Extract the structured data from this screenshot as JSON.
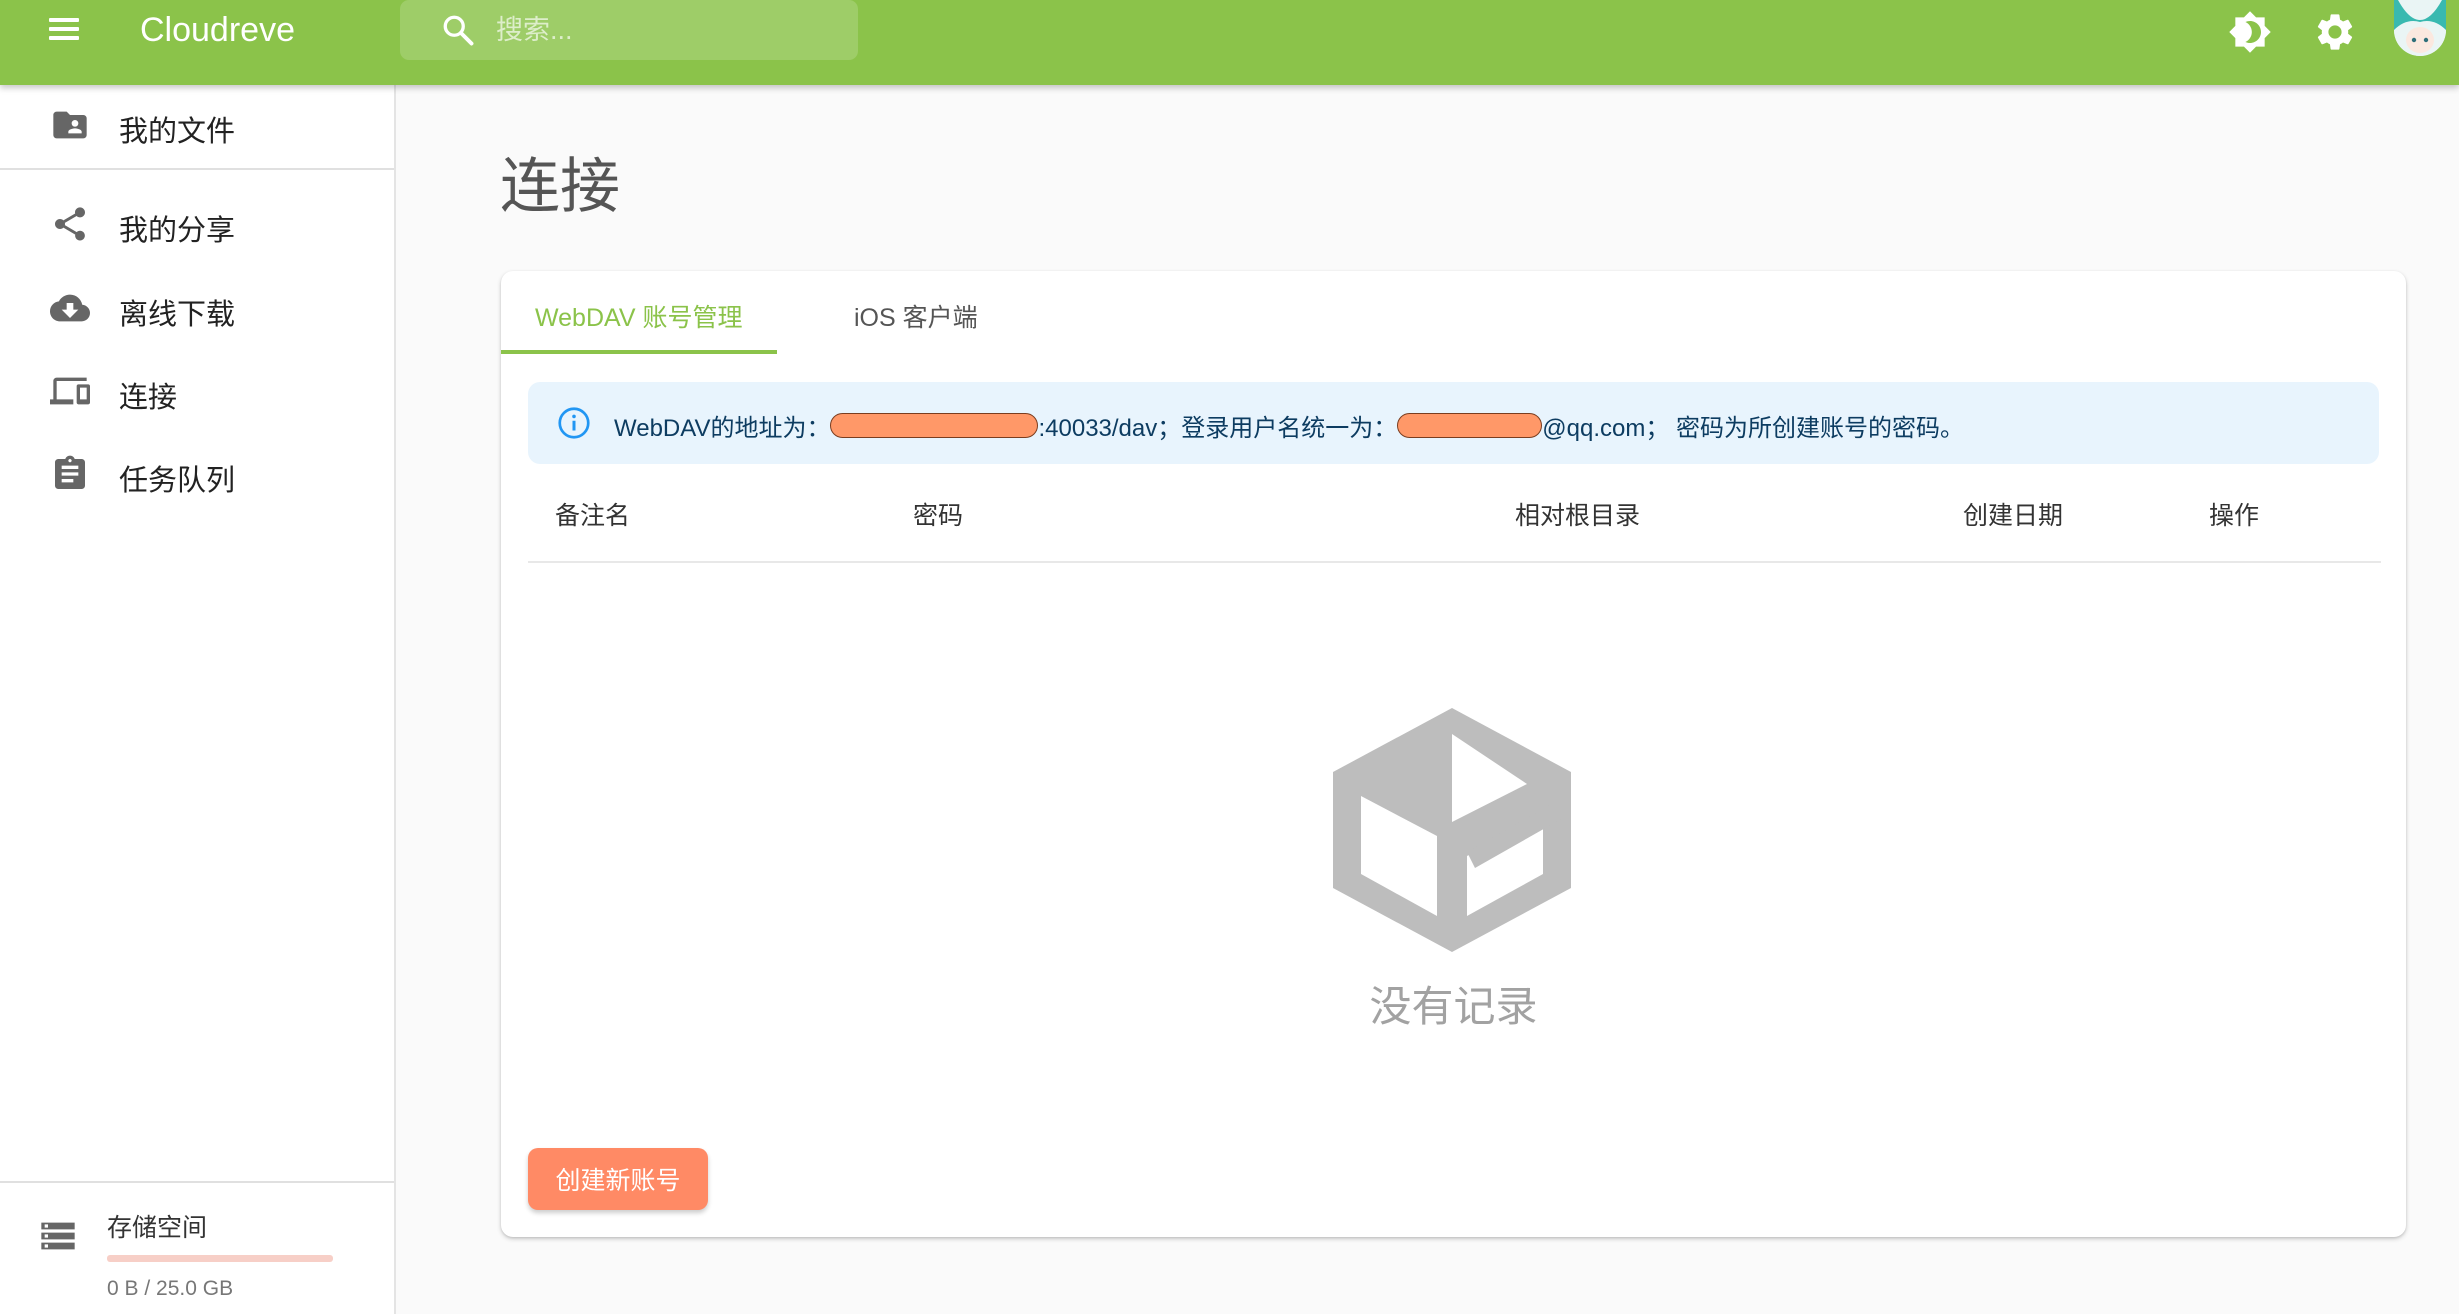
{
  "app": {
    "title": "Cloudreve",
    "search_placeholder": "搜索..."
  },
  "icons": {
    "menu": "menu-icon",
    "search": "search-icon",
    "theme": "brightness-icon",
    "settings": "gear-icon",
    "avatar": "avatar"
  },
  "sidebar": {
    "items": [
      {
        "label": "我的文件",
        "icon": "folder-account-icon"
      },
      {
        "label": "我的分享",
        "icon": "share-icon"
      },
      {
        "label": "离线下载",
        "icon": "cloud-download-icon"
      },
      {
        "label": "连接",
        "icon": "devices-icon"
      },
      {
        "label": "任务队列",
        "icon": "clipboard-icon"
      }
    ],
    "storage": {
      "label": "存储空间",
      "usage_text": "0 B / 25.0 GB",
      "used_fraction": 0
    }
  },
  "main": {
    "page_title": "连接",
    "tabs": [
      {
        "label": "WebDAV 账号管理",
        "active": true
      },
      {
        "label": "iOS 客户端",
        "active": false
      }
    ],
    "alert": {
      "prefix": "WebDAV的地址为：",
      "mid": ":40033/dav；登录用户名统一为：",
      "suffix": "@qq.com；  密码为所创建账号的密码。"
    },
    "table": {
      "headers": [
        "备注名",
        "密码",
        "相对根目录",
        "创建日期",
        "操作"
      ],
      "rows": []
    },
    "empty_text": "没有记录",
    "create_button": "创建新账号"
  },
  "colors": {
    "primary": "#8bc34a",
    "secondary": "#ff8a65",
    "info_bg": "#e8f4fd",
    "info_icon": "#2196f3"
  }
}
